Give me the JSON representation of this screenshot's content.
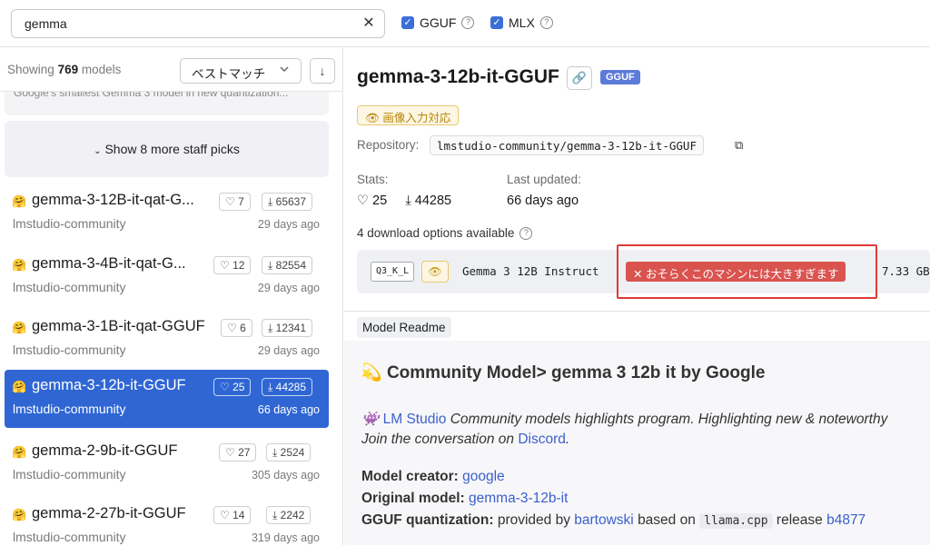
{
  "search": {
    "value": "gemma"
  },
  "filters": [
    {
      "label": "GGUF",
      "checked": true
    },
    {
      "label": "MLX",
      "checked": true
    }
  ],
  "list_header": {
    "showing_prefix": "Showing",
    "count": "769",
    "suffix": "models",
    "sort_label": "ベストマッチ"
  },
  "staff_picks": {
    "tail_text": "Google's smallest Gemma 3 model in new quantization...",
    "more_label": "Show 8 more staff picks"
  },
  "models": [
    {
      "name": "gemma-3-12B-it-qat-G...",
      "org": "lmstudio-community",
      "likes": "7",
      "downloads": "65637",
      "date": "29 days ago",
      "selected": false
    },
    {
      "name": "gemma-3-4B-it-qat-G...",
      "org": "lmstudio-community",
      "likes": "12",
      "downloads": "82554",
      "date": "29 days ago",
      "selected": false
    },
    {
      "name": "gemma-3-1B-it-qat-GGUF",
      "org": "lmstudio-community",
      "likes": "6",
      "downloads": "12341",
      "date": "29 days ago",
      "selected": false
    },
    {
      "name": "gemma-3-12b-it-GGUF",
      "org": "lmstudio-community",
      "likes": "25",
      "downloads": "44285",
      "date": "66 days ago",
      "selected": true
    },
    {
      "name": "gemma-2-9b-it-GGUF",
      "org": "lmstudio-community",
      "likes": "27",
      "downloads": "2524",
      "date": "305 days ago",
      "selected": false
    },
    {
      "name": "gemma-2-27b-it-GGUF",
      "org": "lmstudio-community",
      "likes": "14",
      "downloads": "2242",
      "date": "319 days ago",
      "selected": false
    }
  ],
  "detail": {
    "title": "gemma-3-12b-it-GGUF",
    "badge": "GGUF",
    "vision_label": "画像入力対応",
    "repo_label": "Repository:",
    "repo": "lmstudio-community/gemma-3-12b-it-GGUF",
    "stats_label": "Stats:",
    "likes": "25",
    "downloads": "44285",
    "updated_label": "Last updated:",
    "updated": "66 days ago",
    "download_options": "4 download options available",
    "option": {
      "quant": "Q3_K_L",
      "name": "Gemma 3 12B Instruct",
      "warning": "おそらくこのマシンには大きすぎます",
      "size": "7.33 GB"
    }
  },
  "readme": {
    "tab": "Model Readme",
    "heading": "Community Model> gemma 3 12b it by Google",
    "line1_link": "LM Studio",
    "line1_text": " Community models highlights program. Highlighting new & noteworthy",
    "line2_text": "Join the conversation on ",
    "line2_link": "Discord",
    "creator_label": "Model creator:",
    "creator": "google",
    "original_label": "Original model:",
    "original": "gemma-3-12b-it",
    "quant_label": "GGUF quantization:",
    "quant_text": "provided by",
    "quant_by": "bartowski",
    "quant_based": "based on",
    "quant_code": "llama.cpp",
    "quant_release": "release",
    "quant_ver": "b4877"
  }
}
